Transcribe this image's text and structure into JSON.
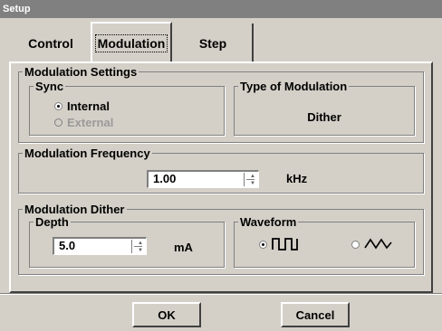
{
  "window": {
    "title": "Setup"
  },
  "tabs": [
    {
      "label": "Control",
      "selected": false
    },
    {
      "label": "Modulation",
      "selected": true
    },
    {
      "label": "Step",
      "selected": false
    }
  ],
  "modulation_settings": {
    "legend": "Modulation Settings",
    "sync": {
      "legend": "Sync",
      "options": [
        {
          "label": "Internal",
          "selected": true,
          "enabled": true
        },
        {
          "label": "External",
          "selected": false,
          "enabled": false
        }
      ]
    },
    "type": {
      "legend": "Type of Modulation",
      "value": "Dither"
    }
  },
  "modulation_frequency": {
    "legend": "Modulation Frequency",
    "value": "1.00",
    "unit": "kHz"
  },
  "modulation_dither": {
    "legend": "Modulation Dither",
    "depth": {
      "legend": "Depth",
      "value": "5.0",
      "unit": "mA"
    },
    "waveform": {
      "legend": "Waveform",
      "options": [
        {
          "icon": "square-wave-icon",
          "selected": true
        },
        {
          "icon": "triangle-wave-icon",
          "selected": false
        }
      ]
    }
  },
  "buttons": {
    "ok": "OK",
    "cancel": "Cancel"
  }
}
